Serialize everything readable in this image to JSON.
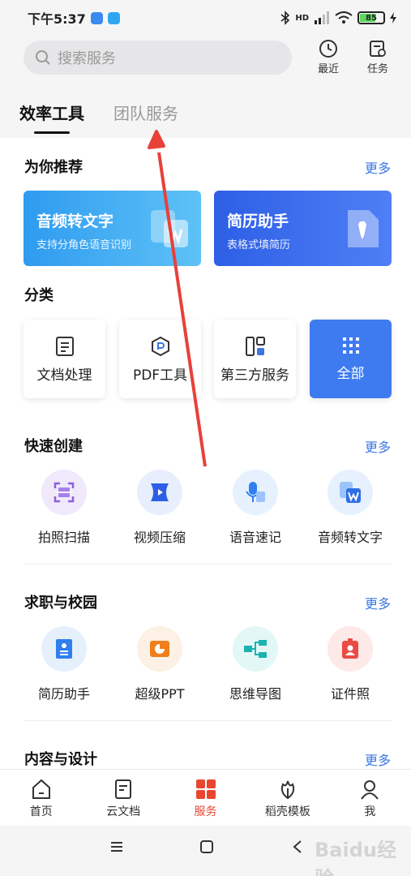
{
  "status": {
    "time": "下午5:37",
    "hd": "HD",
    "battery": "85"
  },
  "search": {
    "placeholder": "搜索服务"
  },
  "header_buttons": {
    "recent": "最近",
    "tasks": "任务"
  },
  "tabs": [
    {
      "label": "效率工具",
      "active": true
    },
    {
      "label": "团队服务",
      "active": false
    }
  ],
  "recommend": {
    "title": "为你推荐",
    "more": "更多",
    "cards": [
      {
        "title": "音频转文字",
        "subtitle": "支持分角色语音识别"
      },
      {
        "title": "简历助手",
        "subtitle": "表格式填简历"
      }
    ]
  },
  "category": {
    "title": "分类",
    "items": [
      "文档处理",
      "PDF工具",
      "第三方服务",
      "全部"
    ]
  },
  "quick": {
    "title": "快速创建",
    "more": "更多",
    "items": [
      "拍照扫描",
      "视频压缩",
      "语音速记",
      "音频转文字"
    ]
  },
  "career": {
    "title": "求职与校园",
    "more": "更多",
    "items": [
      "简历助手",
      "超级PPT",
      "思维导图",
      "证件照"
    ]
  },
  "design": {
    "title": "内容与设计",
    "more": "更多"
  },
  "bottom_nav": [
    {
      "label": "首页",
      "icon": "home-icon"
    },
    {
      "label": "云文档",
      "icon": "document-icon"
    },
    {
      "label": "服务",
      "icon": "grid-icon",
      "active": true
    },
    {
      "label": "稻壳模板",
      "icon": "leaf-icon"
    },
    {
      "label": "我",
      "icon": "user-icon"
    }
  ],
  "watermark": "Baidu经验",
  "colors": {
    "accent": "#3b77e3",
    "active_nav": "#e9462f",
    "annotation_arrow": "#e8413a"
  }
}
